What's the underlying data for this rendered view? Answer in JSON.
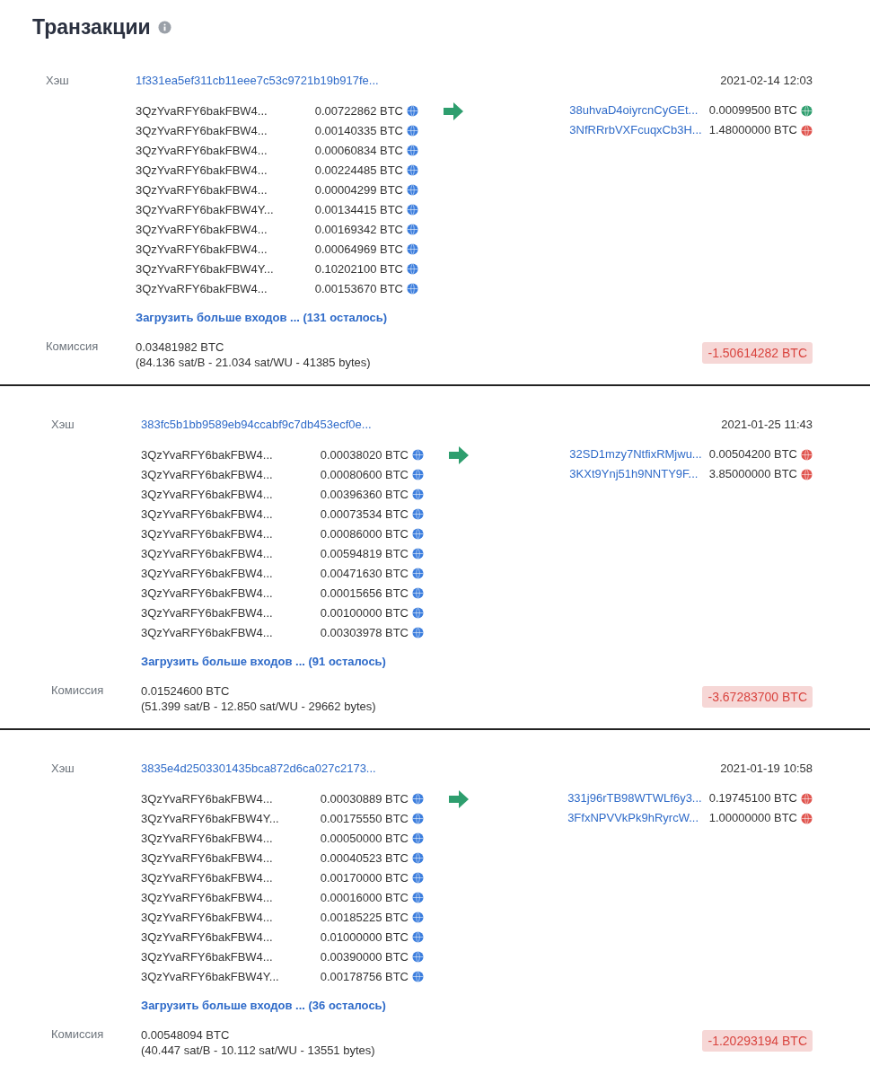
{
  "title": "Транзакции",
  "transactions": [
    {
      "hash_label": "Хэш",
      "hash": "1f331ea5ef311cb11eee7c53c9721b19b917fe...",
      "date": "2021-02-14 12:03",
      "inputs": [
        {
          "address": "3QzYvaRFY6bakFBW4...",
          "amount": "0.00722862 BTC",
          "color": "#3b7ddd"
        },
        {
          "address": "3QzYvaRFY6bakFBW4...",
          "amount": "0.00140335 BTC",
          "color": "#3b7ddd"
        },
        {
          "address": "3QzYvaRFY6bakFBW4...",
          "amount": "0.00060834 BTC",
          "color": "#3b7ddd"
        },
        {
          "address": "3QzYvaRFY6bakFBW4...",
          "amount": "0.00224485 BTC",
          "color": "#3b7ddd"
        },
        {
          "address": "3QzYvaRFY6bakFBW4...",
          "amount": "0.00004299 BTC",
          "color": "#3b7ddd"
        },
        {
          "address": "3QzYvaRFY6bakFBW4Y...",
          "amount": "0.00134415 BTC",
          "color": "#3b7ddd"
        },
        {
          "address": "3QzYvaRFY6bakFBW4...",
          "amount": "0.00169342 BTC",
          "color": "#3b7ddd"
        },
        {
          "address": "3QzYvaRFY6bakFBW4...",
          "amount": "0.00064969 BTC",
          "color": "#3b7ddd"
        },
        {
          "address": "3QzYvaRFY6bakFBW4Y...",
          "amount": "0.10202100 BTC",
          "color": "#3b7ddd"
        },
        {
          "address": "3QzYvaRFY6bakFBW4...",
          "amount": "0.00153670 BTC",
          "color": "#3b7ddd"
        }
      ],
      "outputs": [
        {
          "address": "38uhvaD4oiyrcnCyGEt...",
          "amount": "0.00099500 BTC",
          "color": "#2e9e6e"
        },
        {
          "address": "3NfRRrbVXFcuqxCb3H...",
          "amount": "1.48000000 BTC",
          "color": "#e0544e"
        }
      ],
      "load_more": "Загрузить больше входов ... (131 осталось)",
      "fee_label": "Комиссия",
      "fee": "0.03481982 BTC",
      "fee_details": "(84.136 sat/B - 21.034 sat/WU - 41385 bytes)",
      "total": "-1.50614282 BTC"
    },
    {
      "hash_label": "Хэш",
      "hash": "383fc5b1bb9589eb94ccabf9c7db453ecf0e...",
      "date": "2021-01-25 11:43",
      "inputs": [
        {
          "address": "3QzYvaRFY6bakFBW4...",
          "amount": "0.00038020 BTC",
          "color": "#3b7ddd"
        },
        {
          "address": "3QzYvaRFY6bakFBW4...",
          "amount": "0.00080600 BTC",
          "color": "#3b7ddd"
        },
        {
          "address": "3QzYvaRFY6bakFBW4...",
          "amount": "0.00396360 BTC",
          "color": "#3b7ddd"
        },
        {
          "address": "3QzYvaRFY6bakFBW4...",
          "amount": "0.00073534 BTC",
          "color": "#3b7ddd"
        },
        {
          "address": "3QzYvaRFY6bakFBW4...",
          "amount": "0.00086000 BTC",
          "color": "#3b7ddd"
        },
        {
          "address": "3QzYvaRFY6bakFBW4...",
          "amount": "0.00594819 BTC",
          "color": "#3b7ddd"
        },
        {
          "address": "3QzYvaRFY6bakFBW4...",
          "amount": "0.00471630 BTC",
          "color": "#3b7ddd"
        },
        {
          "address": "3QzYvaRFY6bakFBW4...",
          "amount": "0.00015656 BTC",
          "color": "#3b7ddd"
        },
        {
          "address": "3QzYvaRFY6bakFBW4...",
          "amount": "0.00100000 BTC",
          "color": "#3b7ddd"
        },
        {
          "address": "3QzYvaRFY6bakFBW4...",
          "amount": "0.00303978 BTC",
          "color": "#3b7ddd"
        }
      ],
      "outputs": [
        {
          "address": "32SD1mzy7NtfixRMjwu...",
          "amount": "0.00504200 BTC",
          "color": "#e0544e"
        },
        {
          "address": "3KXt9Ynj51h9NNTY9F...",
          "amount": "3.85000000 BTC",
          "color": "#e0544e"
        }
      ],
      "load_more": "Загрузить больше входов ... (91 осталось)",
      "fee_label": "Комиссия",
      "fee": "0.01524600 BTC",
      "fee_details": "(51.399 sat/B - 12.850 sat/WU - 29662 bytes)",
      "total": "-3.67283700 BTC"
    },
    {
      "hash_label": "Хэш",
      "hash": "3835e4d2503301435bca872d6ca027c2173...",
      "date": "2021-01-19 10:58",
      "inputs": [
        {
          "address": "3QzYvaRFY6bakFBW4...",
          "amount": "0.00030889 BTC",
          "color": "#3b7ddd"
        },
        {
          "address": "3QzYvaRFY6bakFBW4Y...",
          "amount": "0.00175550 BTC",
          "color": "#3b7ddd"
        },
        {
          "address": "3QzYvaRFY6bakFBW4...",
          "amount": "0.00050000 BTC",
          "color": "#3b7ddd"
        },
        {
          "address": "3QzYvaRFY6bakFBW4...",
          "amount": "0.00040523 BTC",
          "color": "#3b7ddd"
        },
        {
          "address": "3QzYvaRFY6bakFBW4...",
          "amount": "0.00170000 BTC",
          "color": "#3b7ddd"
        },
        {
          "address": "3QzYvaRFY6bakFBW4...",
          "amount": "0.00016000 BTC",
          "color": "#3b7ddd"
        },
        {
          "address": "3QzYvaRFY6bakFBW4...",
          "amount": "0.00185225 BTC",
          "color": "#3b7ddd"
        },
        {
          "address": "3QzYvaRFY6bakFBW4...",
          "amount": "0.01000000 BTC",
          "color": "#3b7ddd"
        },
        {
          "address": "3QzYvaRFY6bakFBW4...",
          "amount": "0.00390000 BTC",
          "color": "#3b7ddd"
        },
        {
          "address": "3QzYvaRFY6bakFBW4Y...",
          "amount": "0.00178756 BTC",
          "color": "#3b7ddd"
        }
      ],
      "outputs": [
        {
          "address": "331j96rTB98WTWLf6y3...",
          "amount": "0.19745100 BTC",
          "color": "#e0544e"
        },
        {
          "address": "3FfxNPVVkPk9hRyrcW...",
          "amount": "1.00000000 BTC",
          "color": "#e0544e"
        }
      ],
      "load_more": "Загрузить больше входов ... (36 осталось)",
      "fee_label": "Комиссия",
      "fee": "0.00548094 BTC",
      "fee_details": "(40.447 sat/B - 10.112 sat/WU - 13551 bytes)",
      "total": "-1.20293194 BTC"
    }
  ]
}
